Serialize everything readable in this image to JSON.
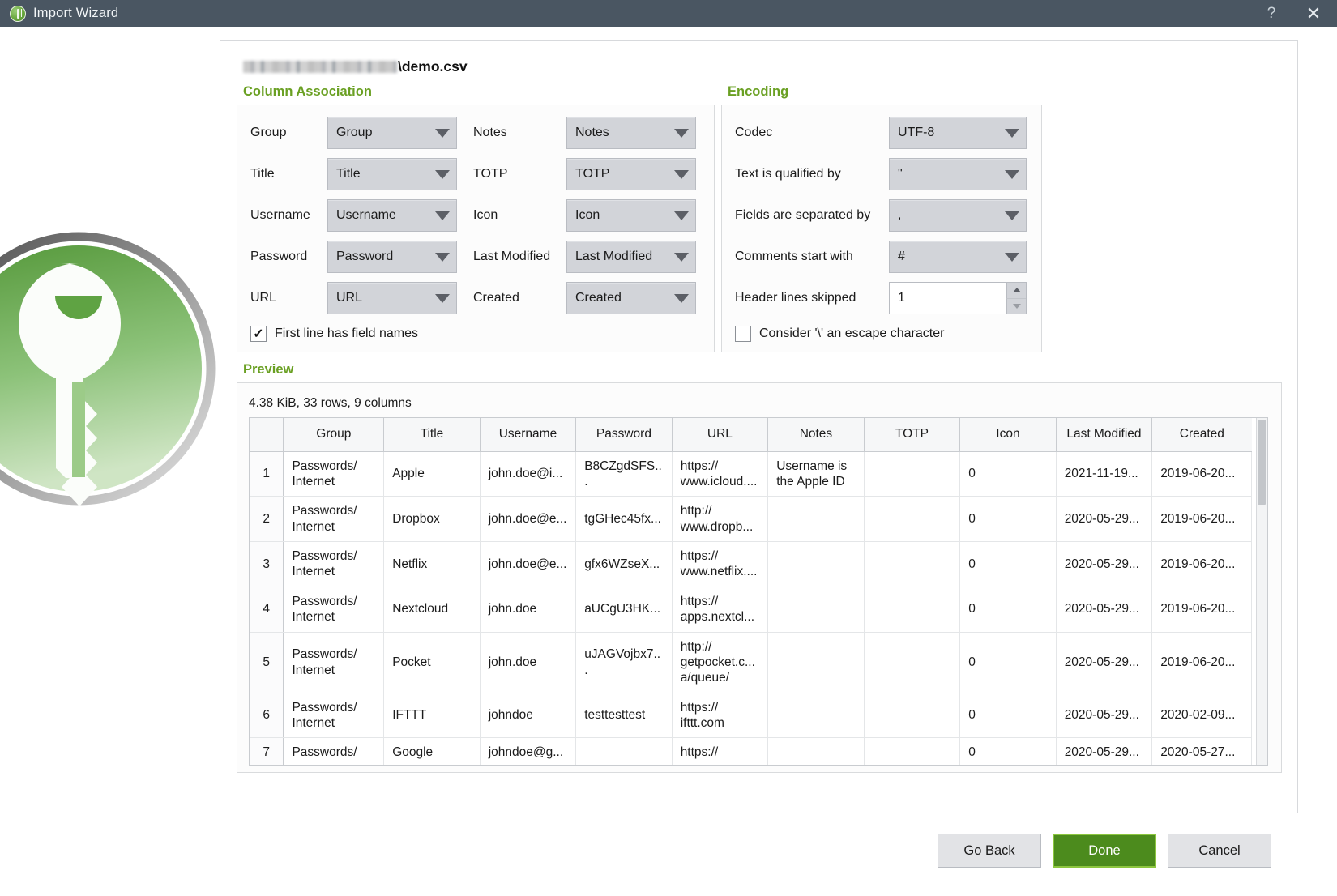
{
  "window": {
    "title": "Import Wizard",
    "logo_icon": "keepassxc-key-icon",
    "help_label": "?",
    "close_label": "✕"
  },
  "file": {
    "redacted_path_placeholder": "",
    "name": "\\demo.csv"
  },
  "column_association": {
    "section_label": "Column Association",
    "left_fields": [
      {
        "label": "Group",
        "value": "Group"
      },
      {
        "label": "Title",
        "value": "Title"
      },
      {
        "label": "Username",
        "value": "Username"
      },
      {
        "label": "Password",
        "value": "Password"
      },
      {
        "label": "URL",
        "value": "URL"
      }
    ],
    "right_fields": [
      {
        "label": "Notes",
        "value": "Notes"
      },
      {
        "label": "TOTP",
        "value": "TOTP"
      },
      {
        "label": "Icon",
        "value": "Icon"
      },
      {
        "label": "Last Modified",
        "value": "Last Modified"
      },
      {
        "label": "Created",
        "value": "Created"
      }
    ],
    "first_line_checkbox": {
      "label": "First line has field names",
      "checked": true,
      "mark": "✓"
    }
  },
  "encoding": {
    "section_label": "Encoding",
    "fields": [
      {
        "label": "Codec",
        "value": "UTF-8"
      },
      {
        "label": "Text is qualified by",
        "value": "\""
      },
      {
        "label": "Fields are separated by",
        "value": ","
      },
      {
        "label": "Comments start with",
        "value": "#"
      }
    ],
    "header_lines": {
      "label": "Header lines skipped",
      "value": "1"
    },
    "escape_checkbox": {
      "label": "Consider '\\' an escape character",
      "checked": false,
      "mark": ""
    }
  },
  "preview": {
    "section_label": "Preview",
    "stats": "4.38 KiB, 33 rows, 9 columns",
    "columns": [
      "",
      "Group",
      "Title",
      "Username",
      "Password",
      "URL",
      "Notes",
      "TOTP",
      "Icon",
      "Last Modified",
      "Created"
    ],
    "rows": [
      [
        "1",
        "Passwords/ Internet",
        "Apple",
        "john.doe@i...",
        "B8CZgdSFS...",
        "https:// www.icloud....",
        "Username is the Apple ID",
        "",
        "0",
        "2021-11-19...",
        "2019-06-20..."
      ],
      [
        "2",
        "Passwords/ Internet",
        "Dropbox",
        "john.doe@e...",
        "tgGHec45fx...",
        "http:// www.dropb...",
        "",
        "",
        "0",
        "2020-05-29...",
        "2019-06-20..."
      ],
      [
        "3",
        "Passwords/ Internet",
        "Netflix",
        "john.doe@e...",
        "gfx6WZseX...",
        "https:// www.netflix....",
        "",
        "",
        "0",
        "2020-05-29...",
        "2019-06-20..."
      ],
      [
        "4",
        "Passwords/ Internet",
        "Nextcloud",
        "john.doe",
        "aUCgU3HK...",
        "https:// apps.nextcl...",
        "",
        "",
        "0",
        "2020-05-29...",
        "2019-06-20..."
      ],
      [
        "5",
        "Passwords/ Internet",
        "Pocket",
        "john.doe",
        "uJAGVojbx7...",
        "http:// getpocket.c... a/queue/",
        "",
        "",
        "0",
        "2020-05-29...",
        "2019-06-20..."
      ],
      [
        "6",
        "Passwords/ Internet",
        "IFTTT",
        "johndoe",
        "testtesttest",
        "https:// ifttt.com",
        "",
        "",
        "0",
        "2020-05-29...",
        "2020-02-09..."
      ],
      [
        "7",
        "Passwords/",
        "Google",
        "johndoe@g...",
        "",
        "https://",
        "",
        "",
        "0",
        "2020-05-29...",
        "2020-05-27..."
      ]
    ]
  },
  "footer": {
    "go_back_label": "Go Back",
    "done_label": "Done",
    "cancel_label": "Cancel"
  },
  "colors": {
    "titlebar": "#4a5662",
    "accent_green": "#6aa023",
    "primary_button": "#4c8b1d"
  }
}
